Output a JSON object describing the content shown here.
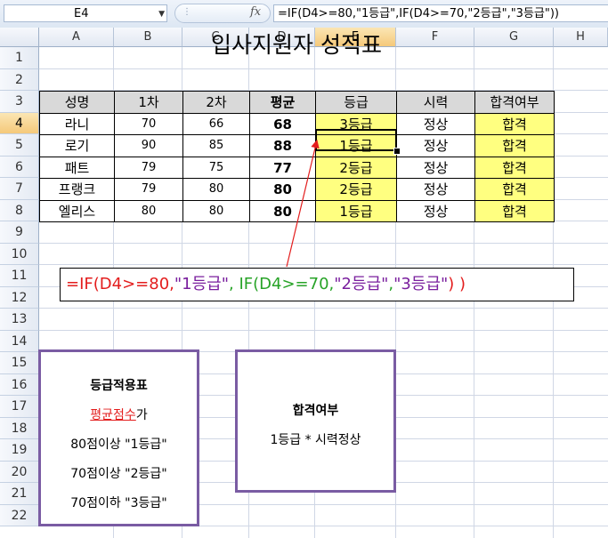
{
  "formula_bar": {
    "name_box": "E4",
    "fx_label": "fx",
    "formula": "=IF(D4>=80,\"1등급\",IF(D4>=70,\"2등급\",\"3등급\"))"
  },
  "columns": [
    "A",
    "B",
    "C",
    "D",
    "E",
    "F",
    "G",
    "H"
  ],
  "selected_column": "E",
  "rows": [
    "1",
    "2",
    "3",
    "4",
    "5",
    "6",
    "7",
    "8",
    "9",
    "10",
    "11",
    "12",
    "13",
    "14",
    "15",
    "16",
    "17",
    "18",
    "19",
    "20",
    "21",
    "22"
  ],
  "selected_row": "4",
  "sheet": {
    "title": "입사지원자 성적표",
    "headers": [
      "성명",
      "1차",
      "2차",
      "평균",
      "등급",
      "시력",
      "합격여부"
    ],
    "records": [
      {
        "name": "라니",
        "first": "70",
        "second": "66",
        "avg": "68",
        "grade": "3등급",
        "vision": "정상",
        "pass": "합격"
      },
      {
        "name": "로기",
        "first": "90",
        "second": "85",
        "avg": "88",
        "grade": "1등급",
        "vision": "정상",
        "pass": "합격"
      },
      {
        "name": "패트",
        "first": "79",
        "second": "75",
        "avg": "77",
        "grade": "2등급",
        "vision": "정상",
        "pass": "합격"
      },
      {
        "name": "프랭크",
        "first": "79",
        "second": "80",
        "avg": "80",
        "grade": "2등급",
        "vision": "정상",
        "pass": "합격"
      },
      {
        "name": "엘리스",
        "first": "80",
        "second": "80",
        "avg": "80",
        "grade": "1등급",
        "vision": "정상",
        "pass": "합격"
      }
    ]
  },
  "formula_callout": {
    "part1": "=IF(D4>=80,",
    "part2": "\"1등급\"",
    "part3": ", IF(D4>=70,",
    "part4": "\"2등급\"",
    "part5": ",",
    "part6": "\"3등급\"",
    "part7": ") )"
  },
  "grade_panel": {
    "title": "등급적용표",
    "subtitle_red": "평균점수",
    "subtitle_rest": "가",
    "lines": [
      "80점이상 \"1등급\"",
      "70점이상 \"2등급\"",
      "70점이하 \"3등급\""
    ]
  },
  "pass_panel": {
    "title": "합격여부",
    "rule": "1등급 * 시력정상"
  },
  "colors": {
    "highlight_yellow": "#ffff80",
    "header_gray": "#d9d9d9",
    "callout_red": "#e31d1d",
    "callout_green": "#27a327",
    "callout_purple": "#7a1f9e",
    "panel_border": "#7a5ca3"
  }
}
